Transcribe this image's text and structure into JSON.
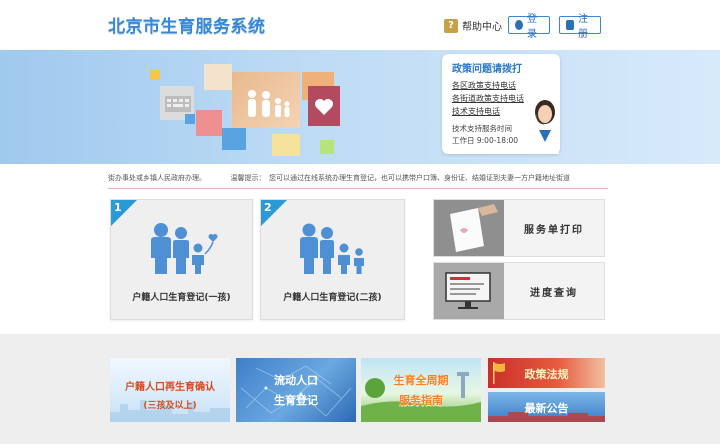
{
  "header": {
    "logo": "北京市生育服务系统",
    "help_label": "帮助中心",
    "login_label": "登录",
    "register_label": "注册"
  },
  "banner": {
    "policy_card": {
      "title": "政策问题请拨打",
      "links": [
        "各区政策支持电话",
        "各街道政策支持电话",
        "技术支持电话"
      ],
      "hours_label": "技术支持服务时间",
      "hours": "工作日 9:00-18:00"
    }
  },
  "notice": {
    "text": "街办事处或乡镇人民政府办理。　　　　温馨提示：　您可以通过在线系统办理生育登记，也可以携带户口簿、身份证、结婚证到夫妻一方户籍地址街道"
  },
  "tiles": [
    {
      "number": "1",
      "label": "户籍人口生育登记(一孩)"
    },
    {
      "number": "2",
      "label": "户籍人口生育登记(二孩)"
    }
  ],
  "service_tiles": {
    "print_label": "服务单打印",
    "progress_label": "进度查询"
  },
  "bottom_tiles": {
    "remarriage": {
      "line1": "户籍人口再生育确认",
      "line2": "(三孩及以上)"
    },
    "floating": {
      "line1": "流动人口",
      "line2": "生育登记"
    },
    "lifecycle": {
      "line1": "生育全周期",
      "line2": "服务指南"
    },
    "policy": {
      "line1": "政策法规"
    },
    "news": {
      "line1": "最新公告"
    }
  },
  "colors": {
    "accent": "#3a87d6",
    "tile_badge": "#2a9ad6",
    "figure": "#4f8fd4"
  }
}
